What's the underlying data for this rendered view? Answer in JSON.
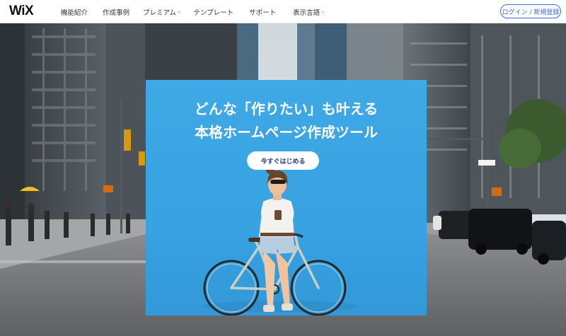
{
  "header": {
    "logo": "WiX",
    "nav": [
      {
        "label": "機能紹介",
        "dropdown": false
      },
      {
        "label": "作成事例",
        "dropdown": false
      },
      {
        "label": "プレミアム",
        "dropdown": true
      },
      {
        "label": "テンプレート",
        "dropdown": false
      },
      {
        "label": "サポート",
        "dropdown": false
      },
      {
        "label": "表示言語",
        "dropdown": true
      }
    ],
    "login_label": "ログイン / 新規登録"
  },
  "hero": {
    "headline_line1": "どんな「作りたい」も叶える",
    "headline_line2": "本格ホームページ作成ツール",
    "cta_label": "今すぐはじめる"
  },
  "colors": {
    "panel_blue": "#3aa3e3",
    "login_accent": "#3a6cf0",
    "cta_text": "#1f3c8c"
  },
  "icons": {
    "dropdown": "chevron-down-icon"
  }
}
